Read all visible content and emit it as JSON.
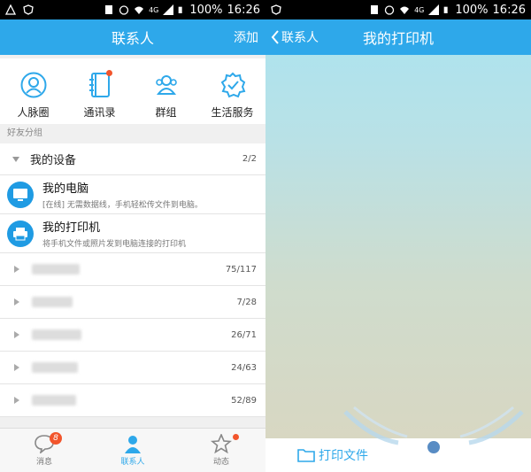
{
  "status": {
    "battery": "100%",
    "time": "16:26",
    "network": "4G"
  },
  "left": {
    "title": "联系人",
    "add_label": "添加",
    "quick": [
      {
        "label": "人脉圈",
        "icon": "person-circle-icon"
      },
      {
        "label": "通讯录",
        "icon": "address-book-icon"
      },
      {
        "label": "群组",
        "icon": "group-icon"
      },
      {
        "label": "生活服务",
        "icon": "life-service-icon"
      }
    ],
    "group_header": "好友分组",
    "my_devices": {
      "label": "我的设备",
      "count": "2/2"
    },
    "devices": [
      {
        "name": "我的电脑",
        "desc": "[在线] 无需数据线，手机轻松传文件到电脑。"
      },
      {
        "name": "我的打印机",
        "desc": "将手机文件或照片发到电脑连接的打印机"
      }
    ],
    "friend_groups": [
      {
        "count": "75/117"
      },
      {
        "count": "7/28"
      },
      {
        "count": "26/71"
      },
      {
        "count": "24/63"
      },
      {
        "count": "52/89"
      }
    ],
    "tabs": [
      {
        "label": "消息",
        "badge": "8"
      },
      {
        "label": "联系人"
      },
      {
        "label": "动态"
      }
    ]
  },
  "right": {
    "back_label": "联系人",
    "title": "我的打印机",
    "print_label": "打印文件"
  },
  "colors": {
    "accent": "#2ea8ea",
    "badge": "#f2552c"
  }
}
